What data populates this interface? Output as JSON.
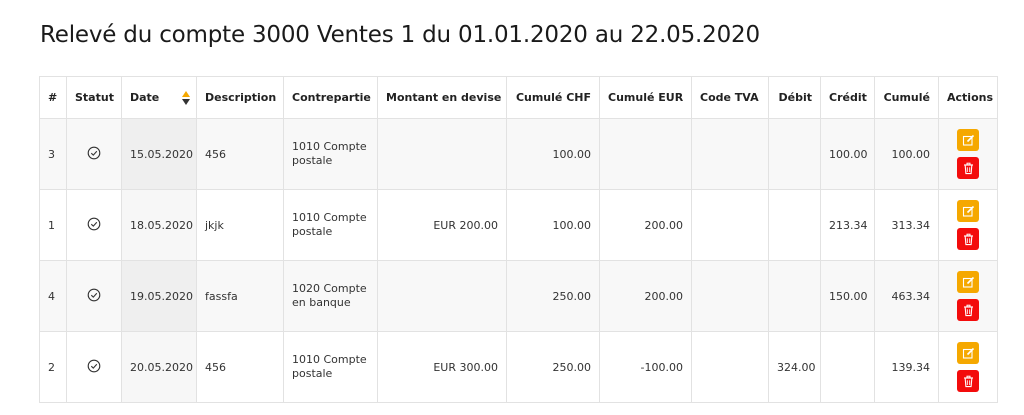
{
  "page": {
    "title": "Relevé du compte 3000 Ventes 1 du 01.01.2020 au 22.05.2020"
  },
  "colors": {
    "edit_button": "#f5a800",
    "delete_button": "#f30c0c",
    "sort_up": "#f5a800",
    "sort_down": "#333333"
  },
  "table": {
    "headers": {
      "num": "#",
      "statut": "Statut",
      "date": "Date",
      "description": "Description",
      "contrepartie": "Contrepartie",
      "montant_devise": "Montant en devise",
      "cumule_chf": "Cumulé CHF",
      "cumule_eur": "Cumulé EUR",
      "code_tva": "Code TVA",
      "debit": "Débit",
      "credit": "Crédit",
      "cumule": "Cumulé",
      "actions": "Actions"
    },
    "rows": [
      {
        "num": "3",
        "status_icon": "check-circle-icon",
        "date": "15.05.2020",
        "description": "456",
        "contrepartie": "1010 Compte postale",
        "montant_devise": "",
        "cumule_chf": "100.00",
        "cumule_eur": "",
        "code_tva": "",
        "debit": "",
        "credit": "100.00",
        "cumule": "100.00"
      },
      {
        "num": "1",
        "status_icon": "check-circle-icon",
        "date": "18.05.2020",
        "description": "jkjk",
        "contrepartie": "1010 Compte postale",
        "montant_devise": "EUR 200.00",
        "cumule_chf": "100.00",
        "cumule_eur": "200.00",
        "code_tva": "",
        "debit": "",
        "credit": "213.34",
        "cumule": "313.34"
      },
      {
        "num": "4",
        "status_icon": "check-circle-icon",
        "date": "19.05.2020",
        "description": "fassfa",
        "contrepartie": "1020 Compte en banque",
        "montant_devise": "",
        "cumule_chf": "250.00",
        "cumule_eur": "200.00",
        "code_tva": "",
        "debit": "",
        "credit": "150.00",
        "cumule": "463.34"
      },
      {
        "num": "2",
        "status_icon": "check-circle-icon",
        "date": "20.05.2020",
        "description": "456",
        "contrepartie": "1010 Compte postale",
        "montant_devise": "EUR 300.00",
        "cumule_chf": "250.00",
        "cumule_eur": "-100.00",
        "code_tva": "",
        "debit": "324.00",
        "credit": "",
        "cumule": "139.34"
      }
    ]
  }
}
